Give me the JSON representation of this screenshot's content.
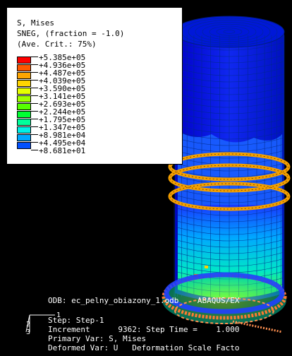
{
  "legend": {
    "title": "S, Mises",
    "subtitle": "SNEG, (fraction = -1.0)",
    "averaging": "(Ave. Crit.: 75%)",
    "items": [
      {
        "value": "+5.385e+05",
        "color": "#ff0000"
      },
      {
        "value": "+4.936e+05",
        "color": "#ff5800"
      },
      {
        "value": "+4.487e+05",
        "color": "#ffa500"
      },
      {
        "value": "+4.039e+05",
        "color": "#ffd400"
      },
      {
        "value": "+3.590e+05",
        "color": "#e6ff00"
      },
      {
        "value": "+3.141e+05",
        "color": "#a0ff00"
      },
      {
        "value": "+2.693e+05",
        "color": "#55ff00"
      },
      {
        "value": "+2.244e+05",
        "color": "#00ff33"
      },
      {
        "value": "+1.795e+05",
        "color": "#00ff9c"
      },
      {
        "value": "+1.347e+05",
        "color": "#00f0e6"
      },
      {
        "value": "+8.981e+04",
        "color": "#00a8ff"
      },
      {
        "value": "+4.495e+04",
        "color": "#0050ff"
      },
      {
        "value": "+8.681e+01",
        "color": "#0000ff"
      }
    ]
  },
  "info": {
    "odb": "ODB: ec_pelny_obiazony_1.odb    ABAQUS/EX",
    "step": "Step: Step-1",
    "increment": "Increment      9362: Step Time =    1.000",
    "primary_var": "Primary Var: S, Mises",
    "deformed_var": "Deformed Var: U   Deformation Scale Facto"
  },
  "triad": {
    "x_label": "1",
    "y_label": "2",
    "z_label": "3"
  },
  "colors": {
    "background": "#000000",
    "mesh": "#003a8a",
    "ring": "#f5a000"
  }
}
